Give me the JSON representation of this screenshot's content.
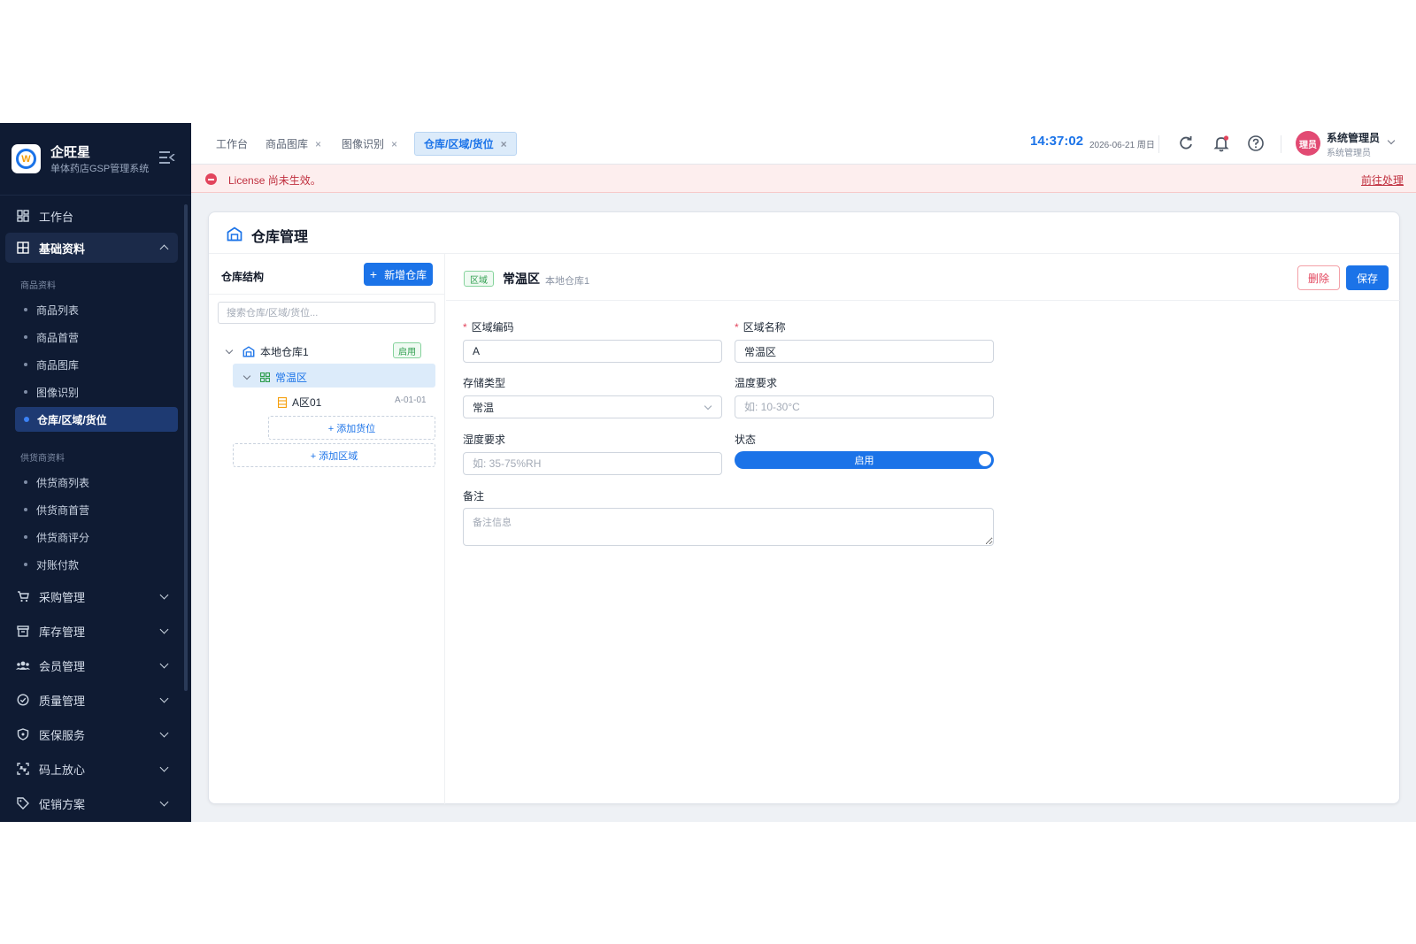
{
  "brand": {
    "name": "企旺星",
    "subtitle": "单体药店GSP管理系统",
    "logo_icon": "w-logo-icon"
  },
  "sidebar": {
    "workbench": "工作台",
    "basic_group": "基础资料",
    "product_section": "商品资料",
    "product_items": [
      "商品列表",
      "商品首营",
      "商品图库",
      "图像识别",
      "仓库/区域/货位"
    ],
    "supplier_section": "供货商资料",
    "supplier_items": [
      "供货商列表",
      "供货商首营",
      "供货商评分",
      "对账付款"
    ],
    "modules": [
      "采购管理",
      "库存管理",
      "会员管理",
      "质量管理",
      "医保服务",
      "码上放心",
      "促销方案"
    ]
  },
  "tabs": [
    {
      "label": "工作台"
    },
    {
      "label": "商品图库",
      "close": "×"
    },
    {
      "label": "图像识别",
      "close": "×"
    },
    {
      "label": "仓库/区域/货位",
      "close": "×",
      "active": true
    }
  ],
  "header": {
    "time": "14:37:02",
    "date": "2026-06-21 周日",
    "avatar_text": "理员",
    "user_name": "系统管理员",
    "user_role": "系统管理员"
  },
  "license": {
    "message": "License 尚未生效。",
    "action": "前往处理"
  },
  "page": {
    "title": "仓库管理",
    "icon": "warehouse-icon"
  },
  "tree": {
    "title": "仓库结构",
    "add_warehouse": "新增仓库",
    "add_plus": "+",
    "search_placeholder": "搜索仓库/区域/货位...",
    "warehouse": {
      "name": "本地仓库1",
      "status": "启用"
    },
    "zone": {
      "name": "常温区"
    },
    "location": {
      "name": "A区01",
      "code": "A-01-01"
    },
    "add_location": "+ 添加货位",
    "add_zone": "+ 添加区域"
  },
  "detail": {
    "tag": "区域",
    "title": "常温区",
    "subtitle": "本地仓库1",
    "delete_label": "删除",
    "save_label": "保存"
  },
  "form": {
    "code_label": "区域编码",
    "code_value": "A",
    "name_label": "区域名称",
    "name_value": "常温区",
    "storage_label": "存储类型",
    "storage_value": "常温",
    "temp_label": "温度要求",
    "temp_placeholder": "如: 10-30°C",
    "humidity_label": "湿度要求",
    "humidity_placeholder": "如: 35-75%RH",
    "status_label": "状态",
    "status_value": "启用",
    "remark_label": "备注",
    "remark_placeholder": "备注信息",
    "required_mark": "*"
  },
  "colors": {
    "primary": "#1b73e8",
    "sidebar_bg": "#0f1b33",
    "danger": "#e2445c",
    "success": "#2f9e4e"
  }
}
